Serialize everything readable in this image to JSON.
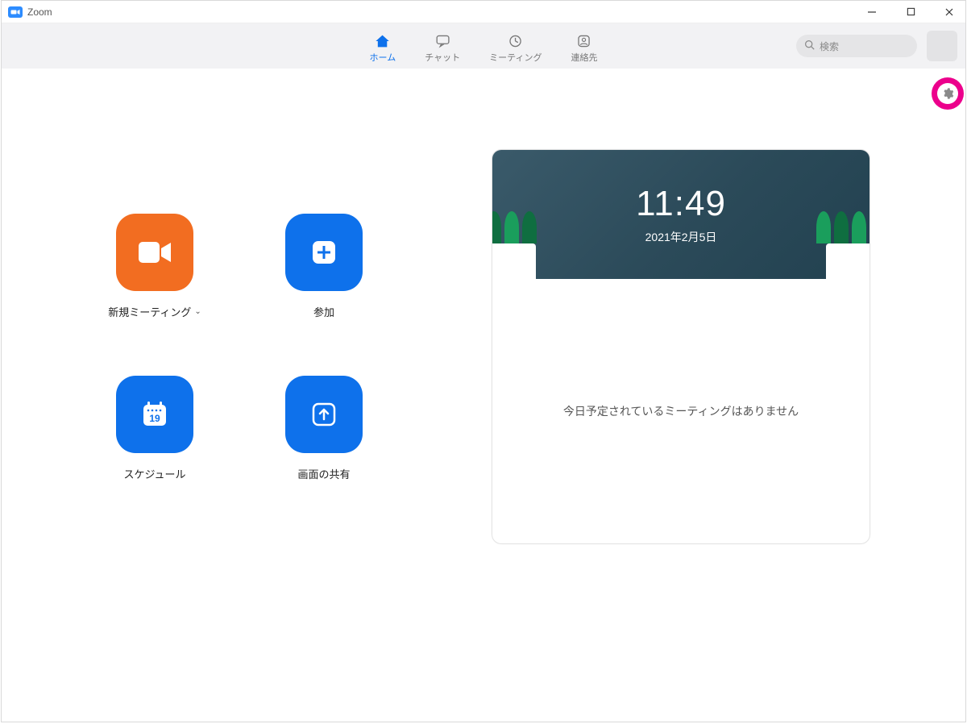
{
  "window": {
    "title": "Zoom"
  },
  "nav": {
    "items": [
      {
        "label": "ホーム"
      },
      {
        "label": "チャット"
      },
      {
        "label": "ミーティング"
      },
      {
        "label": "連絡先"
      }
    ]
  },
  "search": {
    "placeholder": "検索"
  },
  "tiles": {
    "new_meeting": "新規ミーティング",
    "join": "参加",
    "schedule": "スケジュール",
    "share": "画面の共有",
    "calendar_day": "19"
  },
  "card": {
    "time": "11:49",
    "date": "2021年2月5日",
    "empty": "今日予定されているミーティングはありません"
  }
}
